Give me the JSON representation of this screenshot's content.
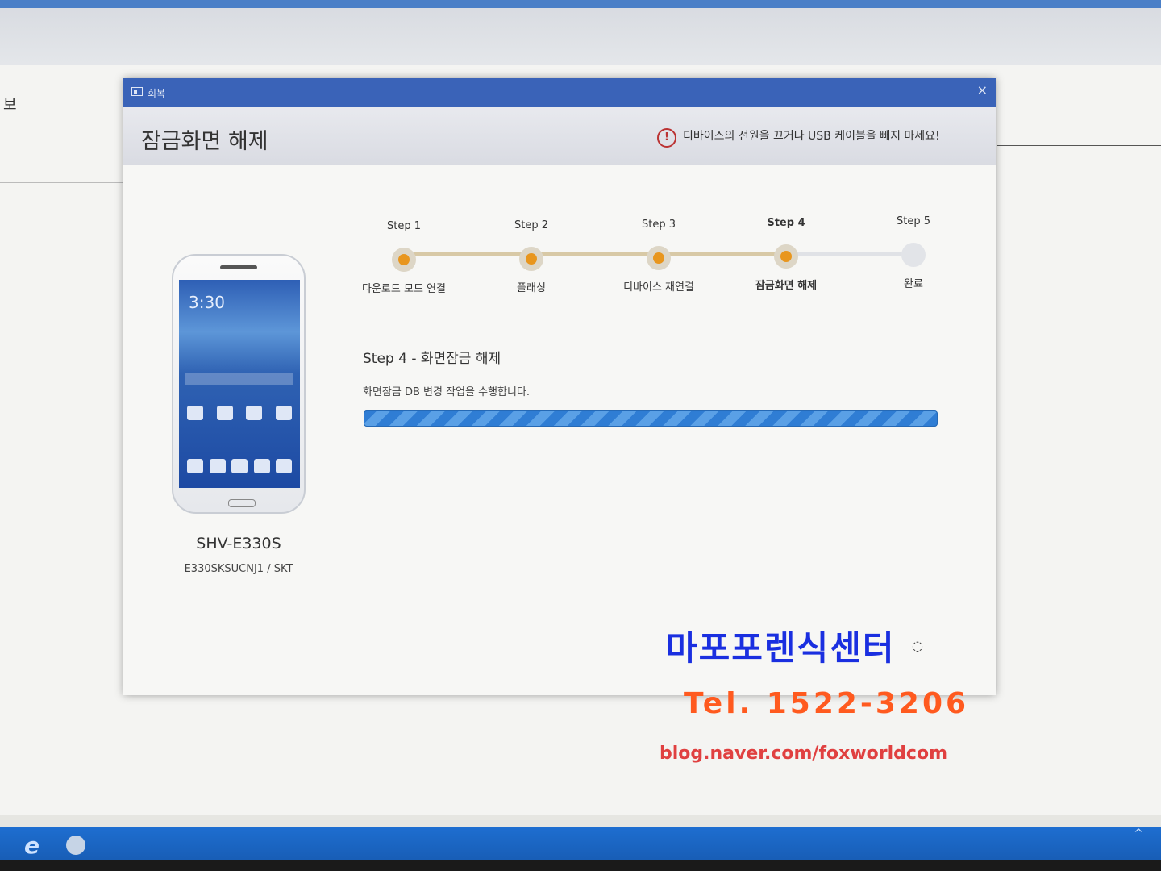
{
  "background": {
    "label": "보"
  },
  "dialog": {
    "window_title": "회복",
    "close_glyph": "×",
    "header_title": "잠금화면 해제",
    "warning_icon": "!",
    "warning_text": "디바이스의 전원을 끄거나 USB 케이블을 빼지 마세요!"
  },
  "device": {
    "clock": "3:30",
    "model": "SHV-E330S",
    "firmware": "E330SKSUCNJ1 / SKT"
  },
  "steps": [
    {
      "label": "Step 1",
      "caption": "다운로드 모드 연결",
      "status": "done"
    },
    {
      "label": "Step 2",
      "caption": "플래싱",
      "status": "done"
    },
    {
      "label": "Step 3",
      "caption": "디바이스 재연결",
      "status": "done"
    },
    {
      "label": "Step 4",
      "caption": "잠금화면 해제",
      "status": "active"
    },
    {
      "label": "Step 5",
      "caption": "완료",
      "status": "pending"
    }
  ],
  "current": {
    "title": "Step 4 - 화면잠금 해제",
    "description": "화면잠금 DB 변경 작업을 수행합니다.",
    "progress": 1.0
  },
  "watermark": {
    "name": "마포포렌식센터",
    "tel": "Tel. 1522-3206",
    "blog": "blog.naver.com/foxworldcom",
    "name_color": "#1a2fe0",
    "tel_color": "#ff5a1f"
  },
  "taskbar": {
    "ie_glyph": "e",
    "tray_glyph": "^"
  }
}
